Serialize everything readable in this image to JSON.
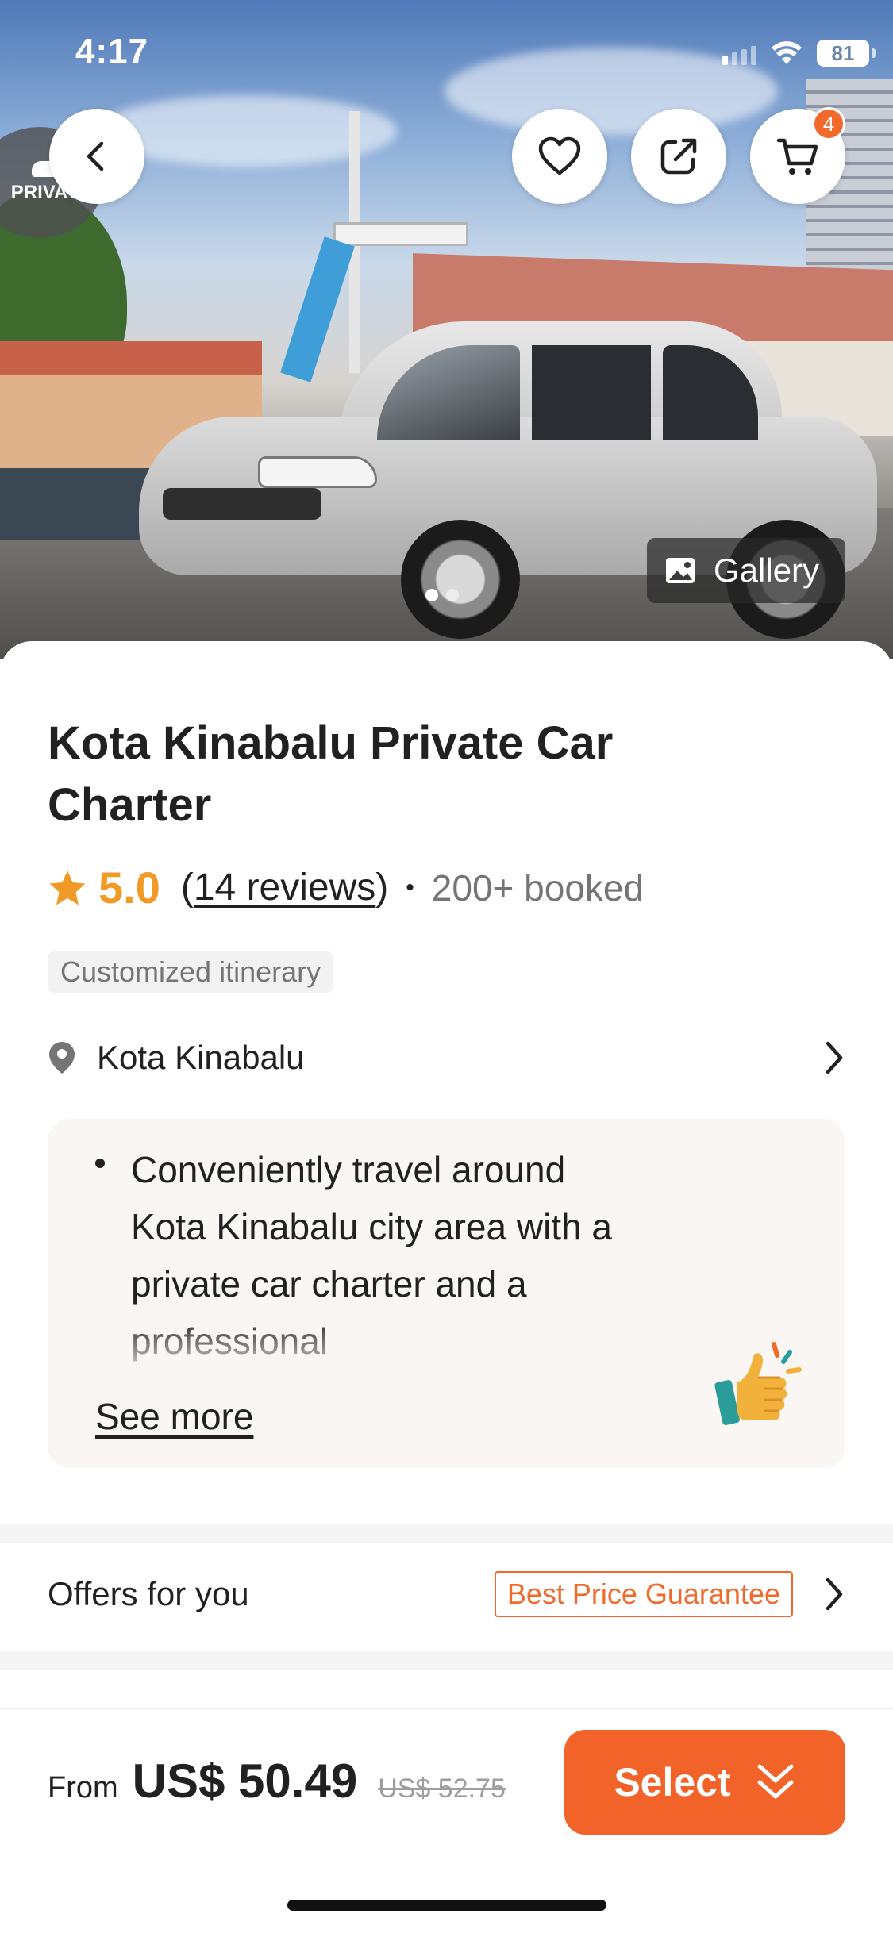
{
  "status_bar": {
    "time": "4:17",
    "battery": "81"
  },
  "hero": {
    "private_badge": "PRIVATE",
    "cart_count": "4",
    "gallery_label": "Gallery"
  },
  "product": {
    "title": "Kota Kinabalu Private Car Charter",
    "rating": "5.0",
    "reviews_open": "(",
    "reviews_link": "14 reviews",
    "reviews_close": ")",
    "separator": "•",
    "booked": "200+ booked",
    "tag": "Customized itinerary",
    "location": "Kota Kinabalu",
    "description": "Conveniently travel around Kota Kinabalu city area with a private car charter and a professional",
    "see_more": "See more"
  },
  "offers": {
    "label": "Offers for you",
    "badge": "Best Price Guarantee"
  },
  "purchase": {
    "from_label": "From",
    "price": "US$ 50.49",
    "original_price": "US$ 52.75",
    "select_label": "Select"
  },
  "icons": [
    "back-icon",
    "heart-icon",
    "share-icon",
    "cart-icon",
    "image-icon",
    "star-icon",
    "location-pin-icon",
    "chevron-right-icon",
    "thumbs-up-icon",
    "double-chevron-down-icon",
    "wifi-icon"
  ],
  "colors": {
    "accent": "#f2632a",
    "rating": "#f09b27",
    "description_bg": "#f9f6f3"
  }
}
